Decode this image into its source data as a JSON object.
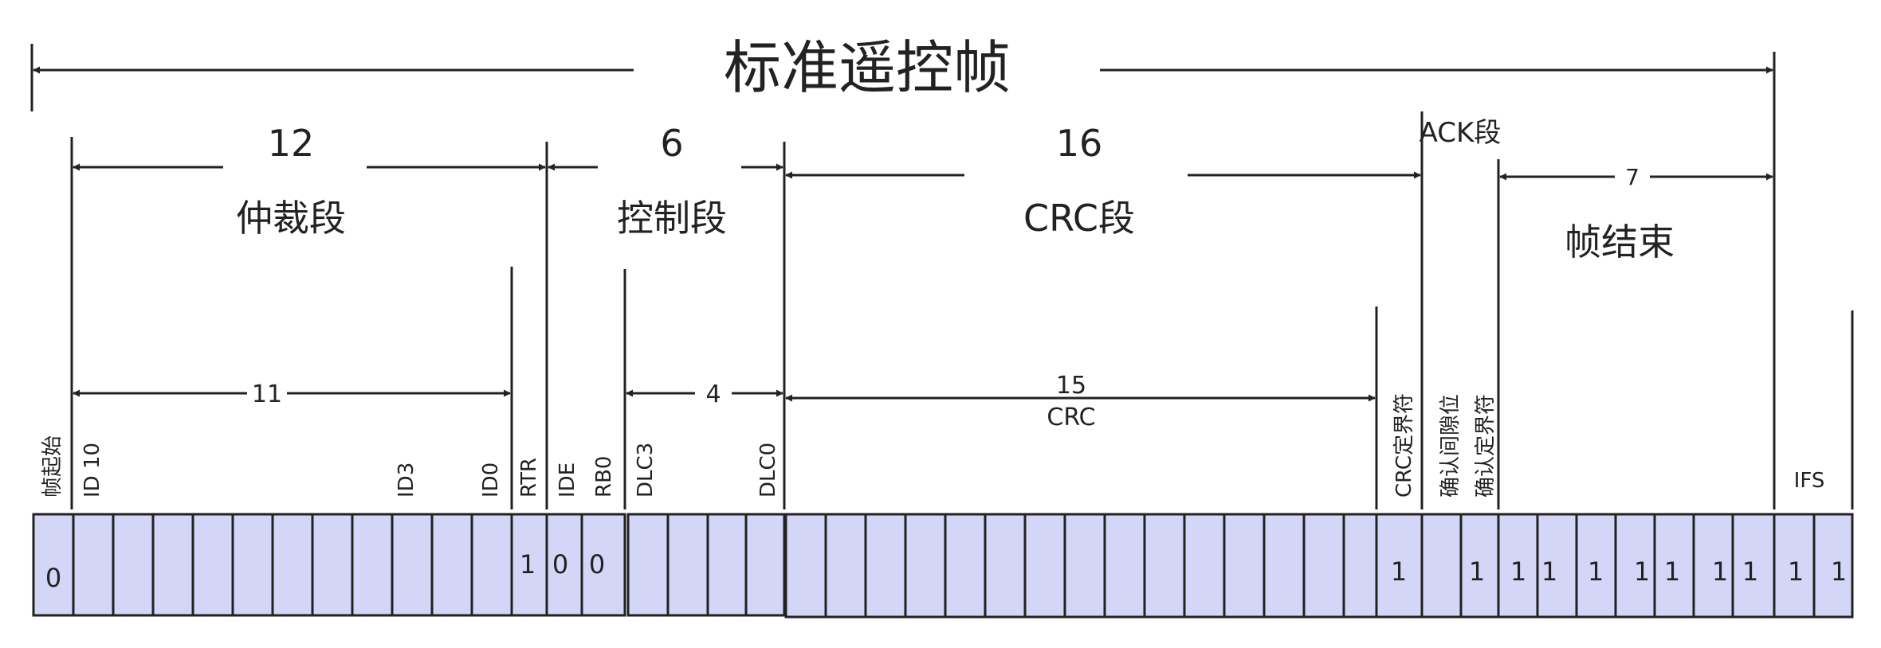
{
  "title": "标准遥控帧",
  "segments": {
    "arbitration": {
      "label": "仲裁段",
      "count": "12"
    },
    "control": {
      "label": "控制段",
      "count": "6"
    },
    "crc": {
      "label": "CRC段",
      "count": "16"
    },
    "ack": {
      "label": "ACK段"
    },
    "eof": {
      "label": "帧结束",
      "count": "7"
    }
  },
  "sub_spans": {
    "id": {
      "count": "11"
    },
    "dlc": {
      "count": "4"
    },
    "crc_seq": {
      "count": "15",
      "label": "CRC"
    }
  },
  "bit_labels": {
    "sof": "帧起始",
    "id10": "ID 10",
    "id3": "ID3",
    "id0": "ID0",
    "rtr": "RTR",
    "ide": "IDE",
    "rb0": "RB0",
    "dlc3": "DLC3",
    "dlc0": "DLC0",
    "crc_delim": "CRC定界符",
    "ack_slot": "确认间隙位",
    "ack_delim": "确认定界符",
    "ifs": "IFS"
  },
  "bit_values": {
    "sof": "0",
    "rtr": "1",
    "ide": "0",
    "rb0": "0",
    "crc_delim": "1",
    "ack_delim": "1",
    "eof": [
      "1",
      "1",
      "1",
      "1",
      "1",
      "1",
      "1"
    ],
    "ifs": [
      "1",
      "1"
    ]
  },
  "colors": {
    "cell_fill": "#d4d6f8",
    "cell_stroke": "#222222",
    "line": "#222222"
  }
}
